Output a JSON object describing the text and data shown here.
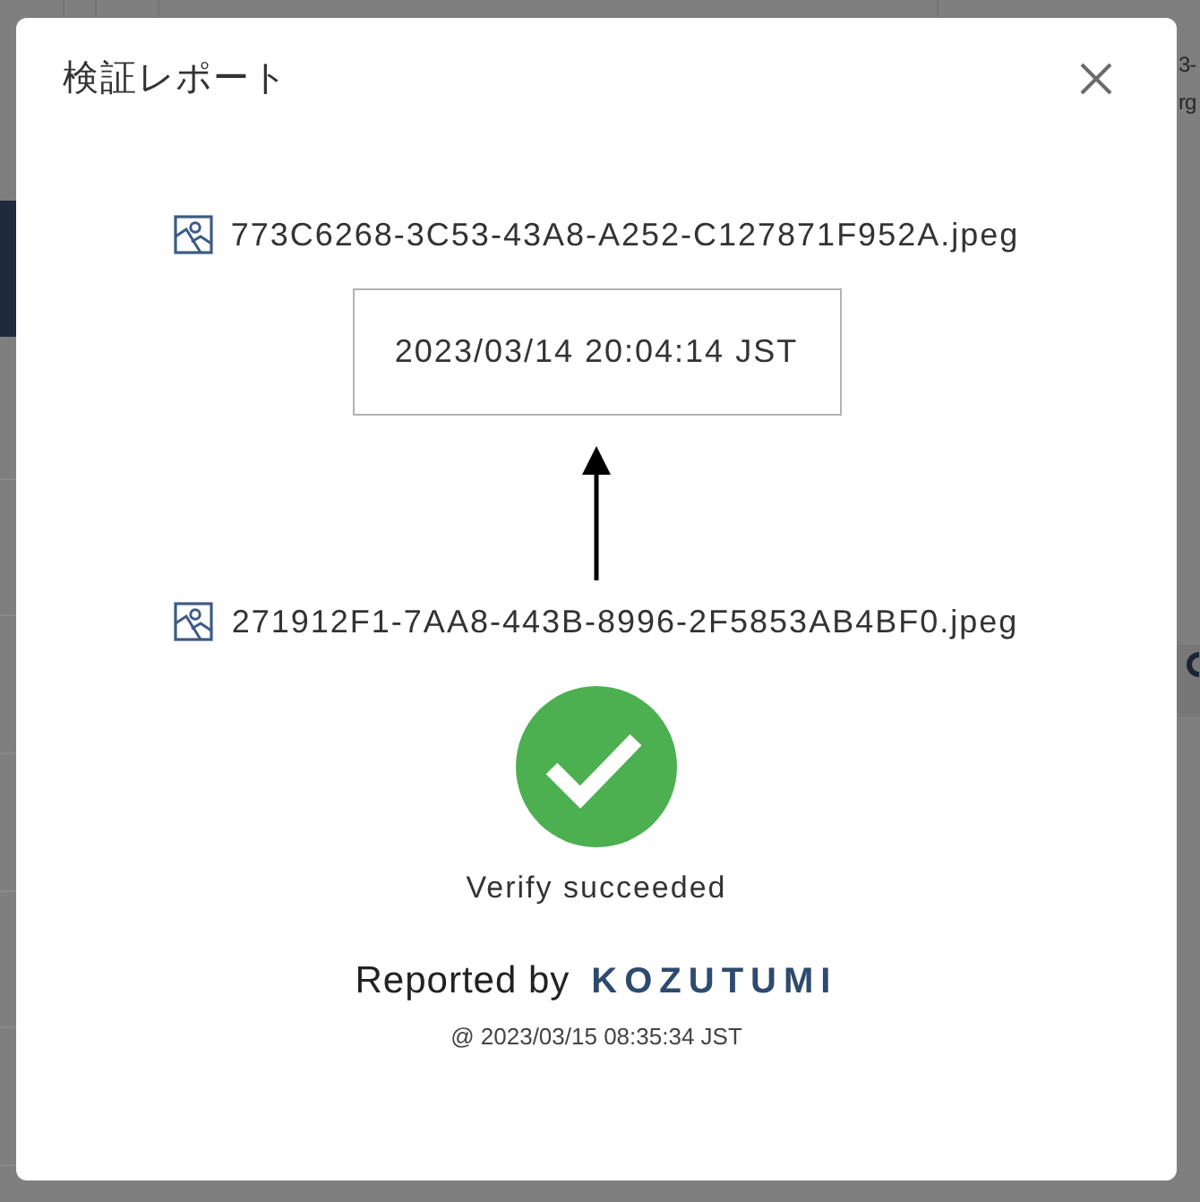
{
  "background": {
    "fragments": [
      "3-",
      "rg"
    ]
  },
  "dialog": {
    "title": "検証レポート"
  },
  "source_file": {
    "name": "773C6268-3C53-43A8-A252-C127871F952A.jpeg"
  },
  "timestamp": "2023/03/14 20:04:14 JST",
  "target_file": {
    "name": "271912F1-7AA8-443B-8996-2F5853AB4BF0.jpeg"
  },
  "result": {
    "verified": true,
    "message": "Verify succeeded"
  },
  "footer": {
    "reported_by": "Reported by",
    "brand": "KOZUTUMI",
    "reported_at": "@ 2023/03/15 08:35:34 JST"
  }
}
